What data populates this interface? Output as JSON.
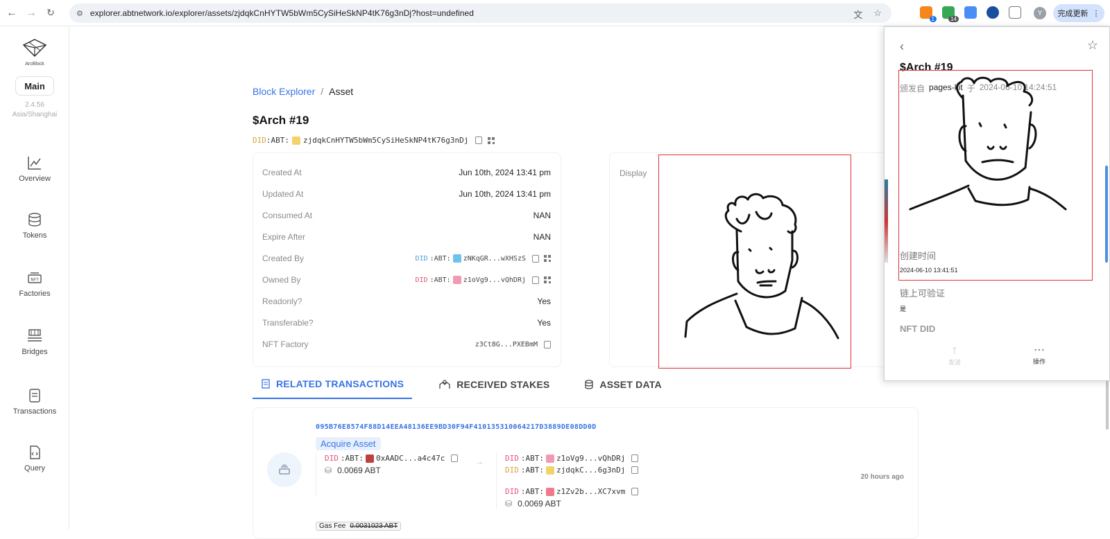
{
  "browser": {
    "url": "explorer.abtnetwork.io/explorer/assets/zjdqkCnHYTW5bWm5CySiHeSkNP4tK76g3nDj?host=undefined",
    "update_label": "完成更新",
    "profile_initial": "Y",
    "extension_badges": [
      "1",
      "14"
    ]
  },
  "sidebar": {
    "logo_text": "ArcBlock",
    "chain": "Main",
    "version": "2.4.56",
    "timezone": "Asia/Shanghai",
    "items": [
      {
        "label": "Overview",
        "icon": "chart-line-icon"
      },
      {
        "label": "Tokens",
        "icon": "coins-icon"
      },
      {
        "label": "Factories",
        "icon": "nft-icon"
      },
      {
        "label": "Bridges",
        "icon": "bridge-icon"
      },
      {
        "label": "Transactions",
        "icon": "document-icon"
      },
      {
        "label": "Query",
        "icon": "code-file-icon"
      }
    ]
  },
  "breadcrumb": {
    "root": "Block Explorer",
    "separator": "/",
    "current": "Asset"
  },
  "asset": {
    "title": "$Arch #19",
    "did_prefix": "DID",
    "did_chain": ":ABT:",
    "did": "zjdqkCnHYTW5bWm5CySiHeSkNP4tK76g3nDj"
  },
  "details": [
    {
      "key": "Created At",
      "value": "Jun 10th, 2024 13:41 pm"
    },
    {
      "key": "Updated At",
      "value": "Jun 10th, 2024 13:41 pm"
    },
    {
      "key": "Consumed At",
      "value": "NAN"
    },
    {
      "key": "Expire After",
      "value": "NAN"
    },
    {
      "key": "Created By",
      "did_prefix": "DID",
      "did_chain": ":ABT:",
      "value": "zNKqGR...wXHSzS"
    },
    {
      "key": "Owned By",
      "did_prefix": "DID",
      "did_chain": ":ABT:",
      "value": "z1oVg9...vQhDRj"
    },
    {
      "key": "Readonly?",
      "value": "Yes"
    },
    {
      "key": "Transferable?",
      "value": "Yes"
    },
    {
      "key": "NFT Factory",
      "value": "z3Ct8G...PXEBmM"
    }
  ],
  "display_label": "Display",
  "tabs": [
    {
      "label": "RELATED TRANSACTIONS",
      "icon": "receipt-icon"
    },
    {
      "label": "RECEIVED STAKES",
      "icon": "stake-hands-icon"
    },
    {
      "label": "ASSET DATA",
      "icon": "database-icon"
    }
  ],
  "transaction": {
    "hash": "095B76E8574F88D14EEA48136EE9BD30F94F410135310064217D3889DE08DD0D",
    "type": "Acquire Asset",
    "from": {
      "did_prefix": "DID",
      "did_chain": ":ABT:",
      "address": "0xAADC...a4c47c",
      "amount": "0.0069 ABT"
    },
    "to": [
      {
        "did_prefix": "DID",
        "did_chain": ":ABT:",
        "address": "z1oVg9...vQhDRj"
      },
      {
        "did_prefix": "DID",
        "did_chain": ":ABT:",
        "address": "zjdqkC...6g3nDj"
      },
      {
        "did_prefix": "DID",
        "did_chain": ":ABT:",
        "address": "z1Zv2b...XC7xvm",
        "amount": "0.0069 ABT"
      }
    ],
    "time": "20 hours ago",
    "gas_label": "Gas Fee",
    "gas_value": "0.0031023 ABT"
  },
  "popup": {
    "title": "$Arch #19",
    "issued_from_label": "颁发自",
    "issuer": "pages-kit",
    "at_label": "于",
    "issued_at": "2024-06-10 14:24:51",
    "created_label": "创建时间",
    "created_value": "2024-06-10 13:41:51",
    "verifiable_label": "链上可验证",
    "verifiable_value": "是",
    "nft_did_label": "NFT DID",
    "send_label": "发送",
    "actions_label": "操作"
  }
}
